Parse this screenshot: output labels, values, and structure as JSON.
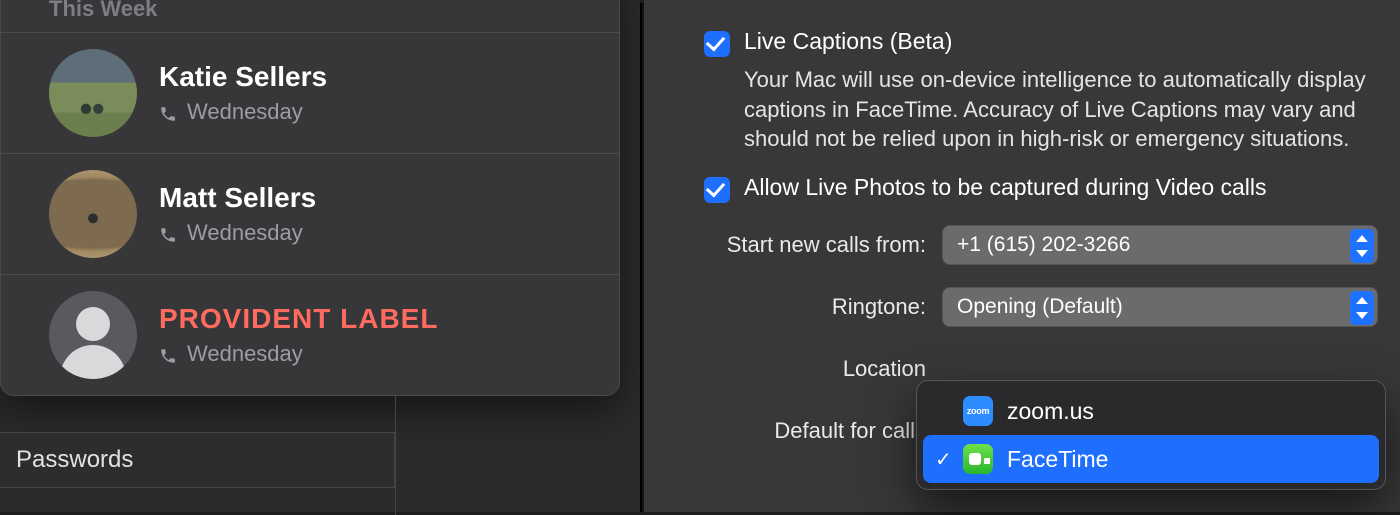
{
  "recents": {
    "section_label": "This Week",
    "items": [
      {
        "name": "Katie Sellers",
        "day": "Wednesday",
        "red": false,
        "avatar": "katie"
      },
      {
        "name": "Matt Sellers",
        "day": "Wednesday",
        "red": false,
        "avatar": "matt"
      },
      {
        "name": "PROVIDENT LABEL",
        "day": "Wednesday",
        "red": true,
        "avatar": "placeholder"
      }
    ]
  },
  "sidebar": {
    "passwords_label": "Passwords"
  },
  "settings": {
    "live_captions": {
      "label": "Live Captions (Beta)",
      "checked": true,
      "description": "Your Mac will use on-device intelligence to automatically display captions in FaceTime. Accuracy of Live Captions may vary and should not be relied upon in high-risk or emergency situations."
    },
    "live_photos": {
      "label": "Allow Live Photos to be captured during Video calls",
      "checked": true
    },
    "start_from": {
      "label": "Start new calls from:",
      "value": "+1 (615) 202-3266"
    },
    "ringtone": {
      "label": "Ringtone:",
      "value": "Opening (Default)"
    },
    "location": {
      "label": "Location"
    },
    "default_for_calls": {
      "label": "Default for calls",
      "options": [
        {
          "icon": "zoom",
          "label": "zoom.us",
          "selected": false
        },
        {
          "icon": "facetime",
          "label": "FaceTime",
          "selected": true
        }
      ]
    }
  }
}
